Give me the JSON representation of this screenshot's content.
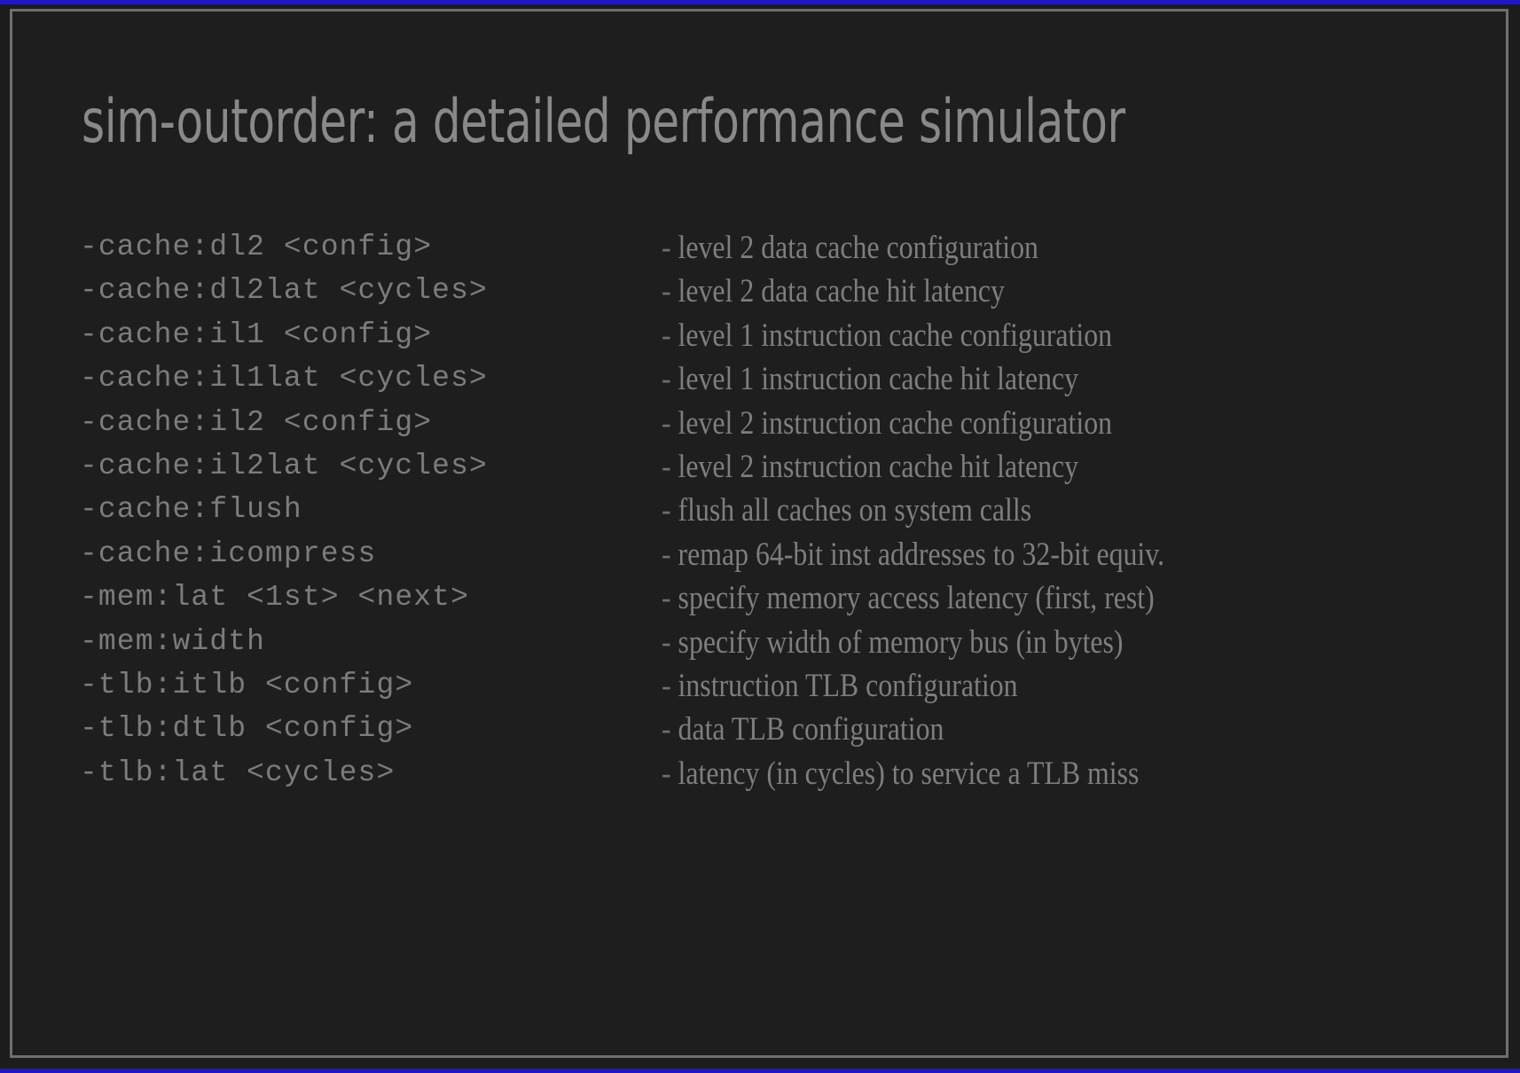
{
  "viewer": {
    "background_color": "#1e1e1e",
    "frame_border_color": "#6f6f6f",
    "accent_strip_color": "#1f16c8",
    "text_color": "#7e7e7e"
  },
  "slide": {
    "title": "sim-outorder: a detailed performance simulator",
    "bullet_prefix": "-",
    "options": [
      {
        "flag": "-cache:dl2 <config>",
        "desc": "level 2 data cache configuration"
      },
      {
        "flag": "-cache:dl2lat <cycles>",
        "desc": "level 2 data cache hit latency"
      },
      {
        "flag": "-cache:il1 <config>",
        "desc": "level 1 instruction cache configuration"
      },
      {
        "flag": "-cache:il1lat <cycles>",
        "desc": "level 1 instruction cache hit latency"
      },
      {
        "flag": "-cache:il2 <config>",
        "desc": "level 2 instruction cache configuration"
      },
      {
        "flag": "-cache:il2lat <cycles>",
        "desc": "level 2 instruction cache hit latency"
      },
      {
        "flag": "-cache:flush",
        "desc": "flush all caches on system calls"
      },
      {
        "flag": "-cache:icompress",
        "desc": "remap 64-bit inst addresses to 32-bit equiv."
      },
      {
        "flag": "-mem:lat <1st> <next>",
        "desc": "specify memory access latency (first, rest)"
      },
      {
        "flag": "-mem:width",
        "desc": "specify width of memory bus (in bytes)"
      },
      {
        "flag": "-tlb:itlb <config>",
        "desc": "instruction TLB configuration"
      },
      {
        "flag": "-tlb:dtlb <config>",
        "desc": "data TLB configuration"
      },
      {
        "flag": "-tlb:lat <cycles>",
        "desc": "latency (in cycles) to service a TLB miss"
      }
    ]
  }
}
